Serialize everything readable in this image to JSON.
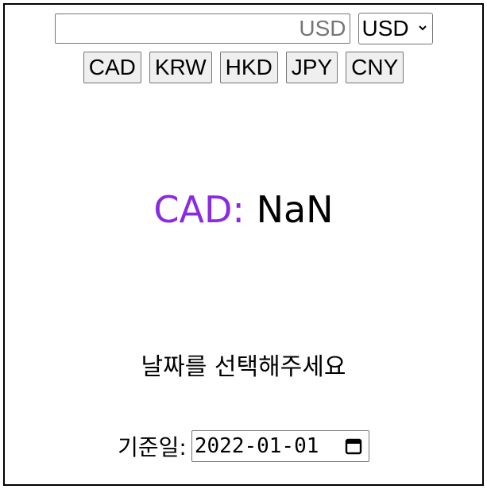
{
  "converter": {
    "amount_placeholder": "USD",
    "selected_currency": "USD"
  },
  "currency_buttons": [
    "CAD",
    "KRW",
    "HKD",
    "JPY",
    "CNY"
  ],
  "result": {
    "code": "CAD:",
    "value": "NaN"
  },
  "message": "날짜를 선택해주세요",
  "date": {
    "label": "기준일:",
    "value": "2022-01-01"
  },
  "colors": {
    "accent": "#8a2be2"
  }
}
